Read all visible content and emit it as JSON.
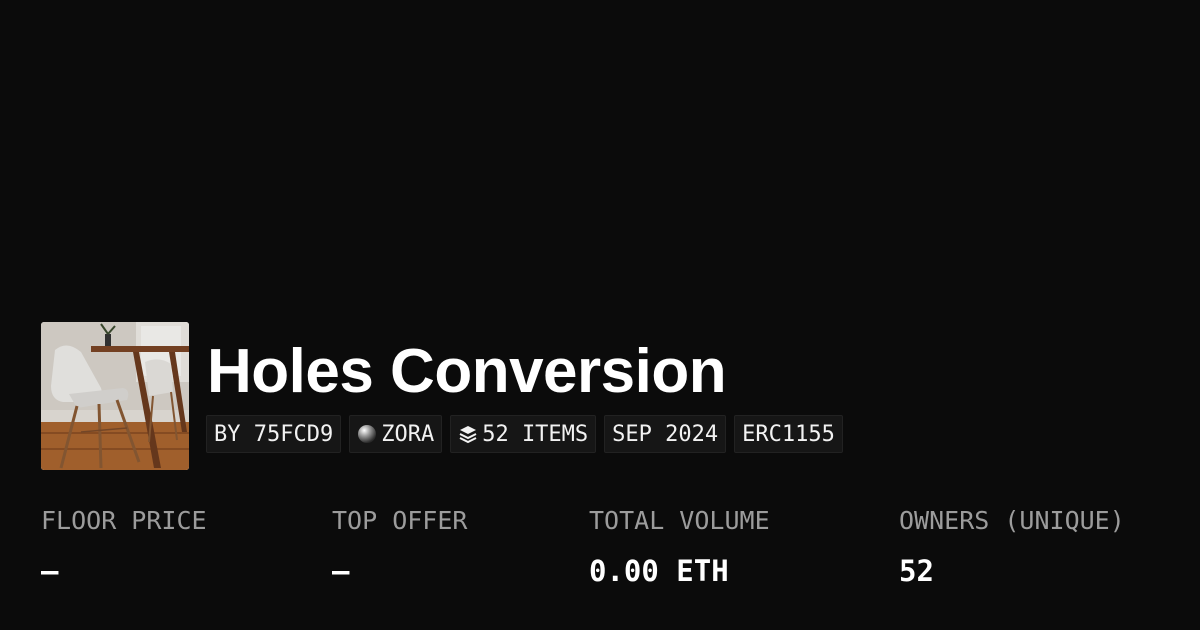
{
  "collection": {
    "title": "Holes Conversion",
    "thumbnail_icon": "chair-table-photo"
  },
  "badges": {
    "creator": "BY 75FCD9",
    "network": "ZORA",
    "network_icon": "zora-orb-icon",
    "items": "52 ITEMS",
    "items_icon": "layers-icon",
    "date": "SEP 2024",
    "standard": "ERC1155"
  },
  "stats": [
    {
      "label": "FLOOR PRICE",
      "value": "–"
    },
    {
      "label": "TOP OFFER",
      "value": "–"
    },
    {
      "label": "TOTAL VOLUME",
      "value": "0.00 ETH"
    },
    {
      "label": "OWNERS (UNIQUE)",
      "value": "52"
    }
  ],
  "colors": {
    "background": "#0b0b0b",
    "badge_bg": "#161616",
    "label": "#9c9c9c",
    "text": "#ffffff"
  }
}
